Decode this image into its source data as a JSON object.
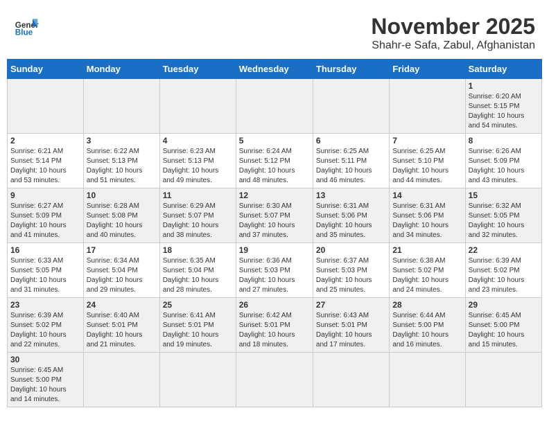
{
  "header": {
    "logo_general": "General",
    "logo_blue": "Blue",
    "month": "November 2025",
    "location": "Shahr-e Safa, Zabul, Afghanistan"
  },
  "weekdays": [
    "Sunday",
    "Monday",
    "Tuesday",
    "Wednesday",
    "Thursday",
    "Friday",
    "Saturday"
  ],
  "weeks": [
    [
      {
        "day": "",
        "info": ""
      },
      {
        "day": "",
        "info": ""
      },
      {
        "day": "",
        "info": ""
      },
      {
        "day": "",
        "info": ""
      },
      {
        "day": "",
        "info": ""
      },
      {
        "day": "",
        "info": ""
      },
      {
        "day": "1",
        "info": "Sunrise: 6:20 AM\nSunset: 5:15 PM\nDaylight: 10 hours\nand 54 minutes."
      }
    ],
    [
      {
        "day": "2",
        "info": "Sunrise: 6:21 AM\nSunset: 5:14 PM\nDaylight: 10 hours\nand 53 minutes."
      },
      {
        "day": "3",
        "info": "Sunrise: 6:22 AM\nSunset: 5:13 PM\nDaylight: 10 hours\nand 51 minutes."
      },
      {
        "day": "4",
        "info": "Sunrise: 6:23 AM\nSunset: 5:13 PM\nDaylight: 10 hours\nand 49 minutes."
      },
      {
        "day": "5",
        "info": "Sunrise: 6:24 AM\nSunset: 5:12 PM\nDaylight: 10 hours\nand 48 minutes."
      },
      {
        "day": "6",
        "info": "Sunrise: 6:25 AM\nSunset: 5:11 PM\nDaylight: 10 hours\nand 46 minutes."
      },
      {
        "day": "7",
        "info": "Sunrise: 6:25 AM\nSunset: 5:10 PM\nDaylight: 10 hours\nand 44 minutes."
      },
      {
        "day": "8",
        "info": "Sunrise: 6:26 AM\nSunset: 5:09 PM\nDaylight: 10 hours\nand 43 minutes."
      }
    ],
    [
      {
        "day": "9",
        "info": "Sunrise: 6:27 AM\nSunset: 5:09 PM\nDaylight: 10 hours\nand 41 minutes."
      },
      {
        "day": "10",
        "info": "Sunrise: 6:28 AM\nSunset: 5:08 PM\nDaylight: 10 hours\nand 40 minutes."
      },
      {
        "day": "11",
        "info": "Sunrise: 6:29 AM\nSunset: 5:07 PM\nDaylight: 10 hours\nand 38 minutes."
      },
      {
        "day": "12",
        "info": "Sunrise: 6:30 AM\nSunset: 5:07 PM\nDaylight: 10 hours\nand 37 minutes."
      },
      {
        "day": "13",
        "info": "Sunrise: 6:31 AM\nSunset: 5:06 PM\nDaylight: 10 hours\nand 35 minutes."
      },
      {
        "day": "14",
        "info": "Sunrise: 6:31 AM\nSunset: 5:06 PM\nDaylight: 10 hours\nand 34 minutes."
      },
      {
        "day": "15",
        "info": "Sunrise: 6:32 AM\nSunset: 5:05 PM\nDaylight: 10 hours\nand 32 minutes."
      }
    ],
    [
      {
        "day": "16",
        "info": "Sunrise: 6:33 AM\nSunset: 5:05 PM\nDaylight: 10 hours\nand 31 minutes."
      },
      {
        "day": "17",
        "info": "Sunrise: 6:34 AM\nSunset: 5:04 PM\nDaylight: 10 hours\nand 29 minutes."
      },
      {
        "day": "18",
        "info": "Sunrise: 6:35 AM\nSunset: 5:04 PM\nDaylight: 10 hours\nand 28 minutes."
      },
      {
        "day": "19",
        "info": "Sunrise: 6:36 AM\nSunset: 5:03 PM\nDaylight: 10 hours\nand 27 minutes."
      },
      {
        "day": "20",
        "info": "Sunrise: 6:37 AM\nSunset: 5:03 PM\nDaylight: 10 hours\nand 25 minutes."
      },
      {
        "day": "21",
        "info": "Sunrise: 6:38 AM\nSunset: 5:02 PM\nDaylight: 10 hours\nand 24 minutes."
      },
      {
        "day": "22",
        "info": "Sunrise: 6:39 AM\nSunset: 5:02 PM\nDaylight: 10 hours\nand 23 minutes."
      }
    ],
    [
      {
        "day": "23",
        "info": "Sunrise: 6:39 AM\nSunset: 5:02 PM\nDaylight: 10 hours\nand 22 minutes."
      },
      {
        "day": "24",
        "info": "Sunrise: 6:40 AM\nSunset: 5:01 PM\nDaylight: 10 hours\nand 21 minutes."
      },
      {
        "day": "25",
        "info": "Sunrise: 6:41 AM\nSunset: 5:01 PM\nDaylight: 10 hours\nand 19 minutes."
      },
      {
        "day": "26",
        "info": "Sunrise: 6:42 AM\nSunset: 5:01 PM\nDaylight: 10 hours\nand 18 minutes."
      },
      {
        "day": "27",
        "info": "Sunrise: 6:43 AM\nSunset: 5:01 PM\nDaylight: 10 hours\nand 17 minutes."
      },
      {
        "day": "28",
        "info": "Sunrise: 6:44 AM\nSunset: 5:00 PM\nDaylight: 10 hours\nand 16 minutes."
      },
      {
        "day": "29",
        "info": "Sunrise: 6:45 AM\nSunset: 5:00 PM\nDaylight: 10 hours\nand 15 minutes."
      }
    ],
    [
      {
        "day": "30",
        "info": "Sunrise: 6:45 AM\nSunset: 5:00 PM\nDaylight: 10 hours\nand 14 minutes."
      },
      {
        "day": "",
        "info": ""
      },
      {
        "day": "",
        "info": ""
      },
      {
        "day": "",
        "info": ""
      },
      {
        "day": "",
        "info": ""
      },
      {
        "day": "",
        "info": ""
      },
      {
        "day": "",
        "info": ""
      }
    ]
  ]
}
